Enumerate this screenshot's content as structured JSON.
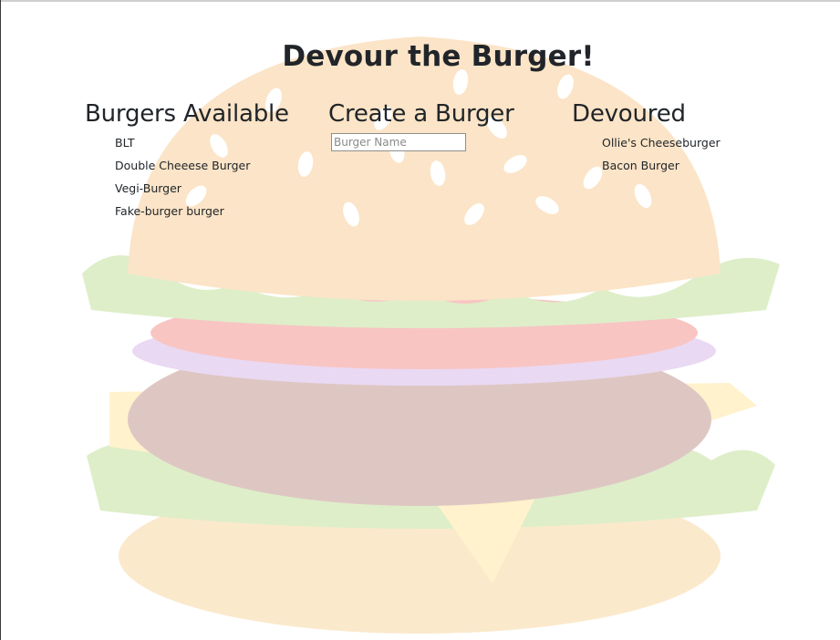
{
  "page": {
    "title": "Devour the Burger!"
  },
  "available": {
    "heading": "Burgers Available",
    "items": [
      "BLT",
      "Double Cheeese Burger",
      "Vegi-Burger",
      "Fake-burger burger"
    ]
  },
  "create": {
    "heading": "Create a Burger",
    "input_placeholder": "Burger Name",
    "input_value": ""
  },
  "devoured": {
    "heading": "Devoured",
    "items": [
      "Ollie's Cheeseburger",
      "Bacon Burger"
    ]
  },
  "colors": {
    "text": "#212529",
    "background": "#ffffff"
  }
}
